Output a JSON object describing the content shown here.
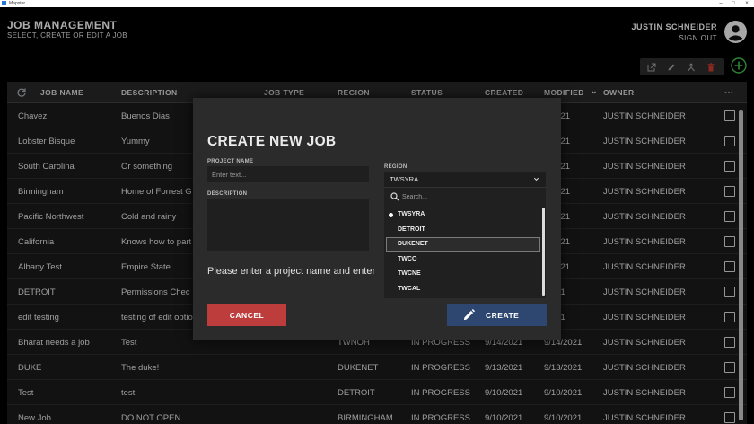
{
  "window": {
    "title": "Mapster"
  },
  "header": {
    "title": "JOB MANAGEMENT",
    "subtitle": "SELECT, CREATE OR EDIT A JOB",
    "user_name": "JUSTIN SCHNEIDER",
    "sign_out": "SIGN OUT"
  },
  "toolbar": {
    "icons": [
      "open-external-icon",
      "edit-icon",
      "merge-icon",
      "delete-icon",
      "add-icon"
    ]
  },
  "table": {
    "columns": [
      "JOB NAME",
      "DESCRIPTION",
      "JOB TYPE",
      "REGION",
      "STATUS",
      "CREATED",
      "MODIFIED",
      "OWNER",
      "..."
    ],
    "sort_indicator": "⌄",
    "rows": [
      {
        "name": "Chavez",
        "description": "Buenos Dias",
        "type": "",
        "region": "",
        "status": "",
        "created": "",
        "modified": "1/2021",
        "owner": "JUSTIN SCHNEIDER"
      },
      {
        "name": "Lobster Bisque",
        "description": "Yummy",
        "type": "",
        "region": "",
        "status": "",
        "created": "",
        "modified": "1/2021",
        "owner": "JUSTIN SCHNEIDER"
      },
      {
        "name": "South Carolina",
        "description": "Or something",
        "type": "",
        "region": "",
        "status": "",
        "created": "",
        "modified": "1/2021",
        "owner": "JUSTIN SCHNEIDER"
      },
      {
        "name": "Birmingham",
        "description": "Home of Forrest G",
        "type": "",
        "region": "",
        "status": "",
        "created": "",
        "modified": "1/2021",
        "owner": "JUSTIN SCHNEIDER"
      },
      {
        "name": "Pacific Northwest",
        "description": "Cold and rainy",
        "type": "",
        "region": "",
        "status": "",
        "created": "",
        "modified": "1/2021",
        "owner": "JUSTIN SCHNEIDER"
      },
      {
        "name": "California",
        "description": "Knows how to part",
        "type": "",
        "region": "",
        "status": "",
        "created": "",
        "modified": "1/2021",
        "owner": "JUSTIN SCHNEIDER"
      },
      {
        "name": "Albany Test",
        "description": "Empire State",
        "type": "",
        "region": "",
        "status": "",
        "created": "",
        "modified": "1/2021",
        "owner": "JUSTIN SCHNEIDER"
      },
      {
        "name": "DETROIT",
        "description": "Permissions Chec",
        "type": "",
        "region": "",
        "status": "",
        "created": "",
        "modified": "/2021",
        "owner": "JUSTIN SCHNEIDER"
      },
      {
        "name": "edit testing",
        "description": "testing of edit optio",
        "type": "",
        "region": "",
        "status": "",
        "created": "",
        "modified": "/2021",
        "owner": "JUSTIN SCHNEIDER"
      },
      {
        "name": "Bharat needs a job",
        "description": "Test",
        "type": "",
        "region": "TWNOH",
        "status": "IN PROGRESS",
        "created": "9/14/2021",
        "modified": "9/14/2021",
        "owner": "JUSTIN SCHNEIDER"
      },
      {
        "name": "DUKE",
        "description": "The duke!",
        "type": "",
        "region": "DUKENET",
        "status": "IN PROGRESS",
        "created": "9/13/2021",
        "modified": "9/13/2021",
        "owner": "JUSTIN SCHNEIDER"
      },
      {
        "name": "Test",
        "description": "test",
        "type": "",
        "region": "DETROIT",
        "status": "IN PROGRESS",
        "created": "9/10/2021",
        "modified": "9/10/2021",
        "owner": "JUSTIN SCHNEIDER"
      },
      {
        "name": "New Job",
        "description": "DO NOT OPEN",
        "type": "",
        "region": "BIRMINGHAM",
        "status": "IN PROGRESS",
        "created": "9/10/2021",
        "modified": "9/10/2021",
        "owner": "JUSTIN SCHNEIDER"
      }
    ]
  },
  "modal": {
    "title": "CREATE NEW JOB",
    "project_name_label": "PROJECT NAME",
    "project_name_placeholder": "Enter text...",
    "description_label": "DESCRIPTION",
    "message": "Please enter a project name and enter",
    "region_label": "REGION",
    "region_value": "TWSYRA",
    "region_search_placeholder": "Search...",
    "region_options": [
      "TWSYRA",
      "DETROIT",
      "DUKENET",
      "TWCO",
      "TWCNE",
      "TWCAL"
    ],
    "region_selected": "TWSYRA",
    "region_highlighted": "DUKENET",
    "cancel_label": "CANCEL",
    "create_label": "CREATE"
  },
  "colors": {
    "cancel": "#bd3c3c",
    "create": "#2e4770",
    "add": "#3fb94a",
    "delete": "#c0392b"
  }
}
